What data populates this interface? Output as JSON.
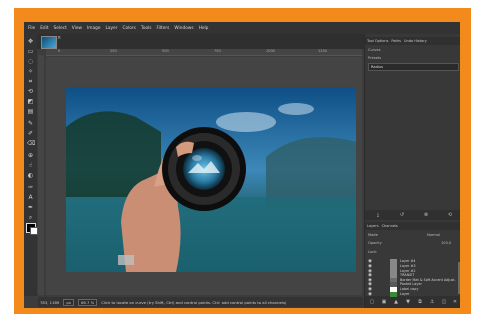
{
  "menu": [
    "File",
    "Edit",
    "Select",
    "View",
    "Image",
    "Layer",
    "Colors",
    "Tools",
    "Filters",
    "Windows",
    "Help"
  ],
  "ruler": [
    "0",
    "250",
    "500",
    "750",
    "1000",
    "1250"
  ],
  "status": {
    "coords": "783, 1189",
    "unit": "px",
    "zoom": "66.7 %",
    "message": "Click to locate on curve (try Shift, Ctrl) and control points. Ctrl: add control points to all channels)"
  },
  "tool_options": {
    "tabs": [
      "Tool Options",
      "Paths",
      "Undo History"
    ],
    "title": "Curves",
    "preset_label": "Presets",
    "preset_value": "Radius"
  },
  "layers": {
    "tabs": [
      "Layers",
      "Channels"
    ],
    "mode_label": "Mode",
    "mode_value": "Normal",
    "opacity_label": "Opacity",
    "opacity_value": "100.0",
    "lock_label": "Lock:",
    "items": [
      "Layer #4",
      "Layer #3",
      "Layer #2",
      "TRANSIT",
      "Border Mat & Soft Accent Adjust.",
      "Pasted Layer",
      "Label copy",
      "Layer"
    ]
  },
  "colors": {
    "accent_frame": "#f28a1c",
    "panel_bg": "#383838"
  }
}
